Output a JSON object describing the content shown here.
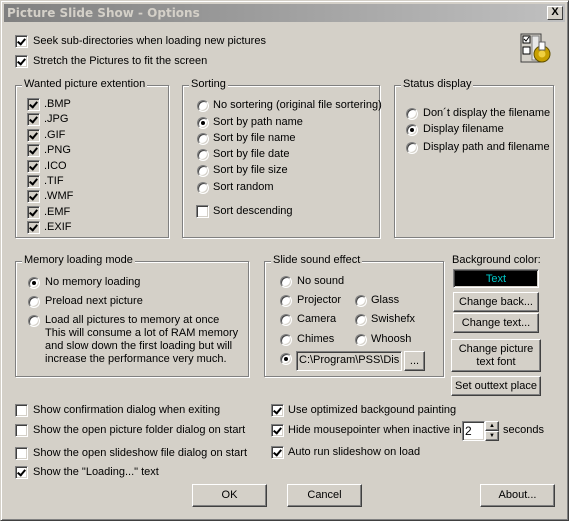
{
  "window": {
    "title": "Picture Slide Show - Options",
    "close_label": "X"
  },
  "top_options": [
    {
      "label": "Seek sub-directories when loading new pictures",
      "checked": true
    },
    {
      "label": "Stretch the Pictures to fit the screen",
      "checked": true
    }
  ],
  "extensions": {
    "title": "Wanted picture extention",
    "items": [
      {
        "label": ".BMP",
        "checked": true
      },
      {
        "label": ".JPG",
        "checked": true
      },
      {
        "label": ".GIF",
        "checked": true
      },
      {
        "label": ".PNG",
        "checked": true
      },
      {
        "label": ".ICO",
        "checked": true
      },
      {
        "label": ".TIF",
        "checked": true
      },
      {
        "label": ".WMF",
        "checked": true
      },
      {
        "label": ".EMF",
        "checked": true
      },
      {
        "label": ".EXIF",
        "checked": true
      }
    ]
  },
  "sorting": {
    "title": "Sorting",
    "options": [
      {
        "label": "No sortering (original file sortering)",
        "selected": false
      },
      {
        "label": "Sort by path name",
        "selected": true
      },
      {
        "label": "Sort by file name",
        "selected": false
      },
      {
        "label": "Sort by file date",
        "selected": false
      },
      {
        "label": "Sort by file size",
        "selected": false
      },
      {
        "label": "Sort random",
        "selected": false
      }
    ],
    "descending_label": "Sort descending",
    "descending_checked": false
  },
  "status_display": {
    "title": "Status display",
    "options": [
      {
        "label": "Don´t display the filename",
        "selected": false
      },
      {
        "label": "Display filename",
        "selected": true
      },
      {
        "label": "Display path and filename",
        "selected": false
      }
    ]
  },
  "memory": {
    "title": "Memory loading mode",
    "options": [
      {
        "label": "No memory loading",
        "selected": true
      },
      {
        "label": "Preload next picture",
        "selected": false
      },
      {
        "label": "Load all pictures to memory at once",
        "selected": false
      }
    ],
    "description": [
      "This will consume a lot of RAM memory",
      "and slow down the first loading but will",
      "increase the performance very much."
    ]
  },
  "sound": {
    "title": "Slide sound effect",
    "options": {
      "no_sound": {
        "label": "No sound",
        "selected": false
      },
      "projector": {
        "label": "Projector",
        "selected": false
      },
      "glass": {
        "label": "Glass",
        "selected": false
      },
      "camera": {
        "label": "Camera",
        "selected": false
      },
      "swishefx": {
        "label": "Swishefx",
        "selected": false
      },
      "chimes": {
        "label": "Chimes",
        "selected": false
      },
      "whoosh": {
        "label": "Whoosh",
        "selected": false
      },
      "custom": {
        "selected": true
      }
    },
    "custom_path": "C:\\Program\\PSS\\Dis",
    "browse_label": "..."
  },
  "colors": {
    "background_label": "Background color:",
    "preview_text": "Text",
    "preview_bg": "#000000",
    "preview_fg": "#00c8c8",
    "change_back_label": "Change back...",
    "change_text_label": "Change text...",
    "change_font_label_1": "Change picture",
    "change_font_label_2": "text font",
    "set_outtext_label": "Set outtext place"
  },
  "bottom_left": [
    {
      "label": "Show confirmation dialog when exiting",
      "checked": false
    },
    {
      "label": "Show the open picture folder dialog on start",
      "checked": false
    },
    {
      "label": "Show the open slideshow file dialog on start",
      "checked": false
    },
    {
      "label": "Show the \"Loading...\" text",
      "checked": true
    }
  ],
  "bottom_right": {
    "optimized_label": "Use optimized backgound painting",
    "optimized_checked": true,
    "hide_mouse_label": "Hide mousepointer when inactive in",
    "hide_mouse_checked": true,
    "hide_mouse_seconds": "2",
    "seconds_label": "seconds",
    "autorun_label": "Auto run slideshow on load",
    "autorun_checked": true
  },
  "buttons": {
    "ok": "OK",
    "cancel": "Cancel",
    "about": "About..."
  }
}
